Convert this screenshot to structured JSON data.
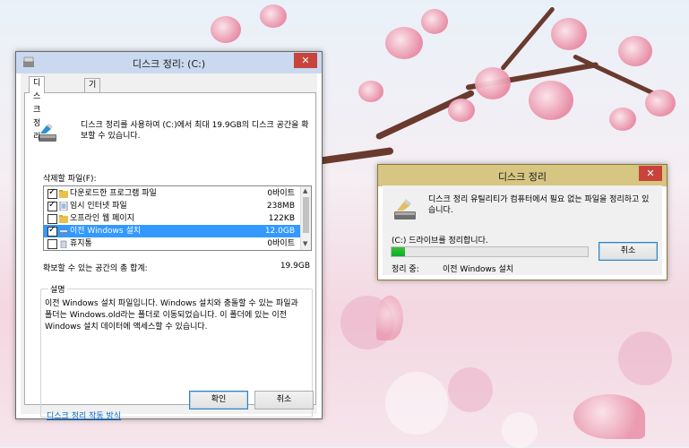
{
  "main_window": {
    "title": "디스크 정리: (C:)",
    "close_glyph": "✕",
    "tabs": [
      {
        "label": "디스크 정리",
        "active": true
      },
      {
        "label": "기타 옵션",
        "active": false
      }
    ],
    "intro_text": "디스크 정리를 사용하여 (C:)에서 최대 19.9GB의 디스크 공간을 확보할 수 있습니다.",
    "files_label": "삭제할 파일(F):",
    "files": [
      {
        "name": "다운로드한 프로그램 파일",
        "size": "0바이트",
        "checked": true,
        "selected": false,
        "icon": "folder-icon"
      },
      {
        "name": "임시 인터넷 파일",
        "size": "238MB",
        "checked": true,
        "selected": false,
        "icon": "page-icon"
      },
      {
        "name": "오프라인 웹 페이지",
        "size": "122KB",
        "checked": false,
        "selected": false,
        "icon": "folder-icon"
      },
      {
        "name": "이전 Windows 설치",
        "size": "12.0GB",
        "checked": true,
        "selected": true,
        "icon": "drive-icon"
      },
      {
        "name": "휴지통",
        "size": "0바이트",
        "checked": false,
        "selected": false,
        "icon": "recycle-bin-icon"
      }
    ],
    "total_label": "확보할 수 있는 공간의 총 합계:",
    "total_value": "19.9GB",
    "description_label": "설명",
    "description_text": "이전 Windows 설치 파일입니다. Windows 설치와 충돌할 수 있는 파일과 폴더는 Windows.old라는 폴더로 이동되었습니다. 이 폴더에 있는 이전 Windows 설치 데이터에 액세스할 수 있습니다.",
    "help_link": "디스크 정리 작동 방식",
    "ok_label": "확인",
    "cancel_label": "취소"
  },
  "progress_window": {
    "title": "디스크 정리",
    "close_glyph": "✕",
    "intro_text": "디스크 정리 유틸리티가 컴퓨터에서 필요 없는 파일을 정리하고 있습니다.",
    "status_text": "(C:) 드라이브를 정리합니다.",
    "progress": 0.07,
    "cleaning_label": "정리 중:",
    "cleaning_value": "이전 Windows 설치",
    "cancel_label": "취소"
  },
  "colors": {
    "accent": "#3399ff",
    "close": "#c7433c",
    "progress": "#06b025"
  }
}
